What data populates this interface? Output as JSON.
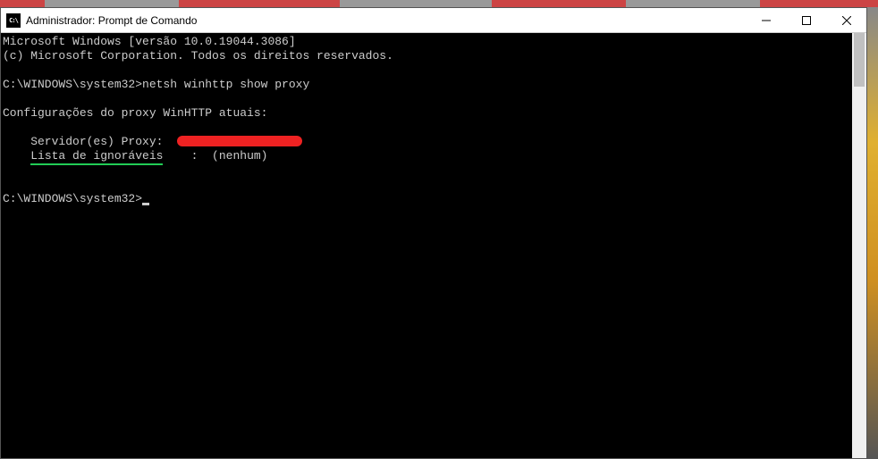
{
  "titlebar": {
    "icon_text": "C:\\",
    "title": "Administrador: Prompt de Comando"
  },
  "terminal": {
    "line1": "Microsoft Windows [versão 10.0.19044.3086]",
    "line2": "(c) Microsoft Corporation. Todos os direitos reservados.",
    "prompt1_path": "C:\\WINDOWS\\system32>",
    "command1": "netsh winhttp show proxy",
    "config_header": "Configurações do proxy WinHTTP atuais:",
    "proxy_label": "    Servidor(es) Proxy:  ",
    "bypass_label_indent": "    ",
    "bypass_label": "Lista de ignoráveis",
    "bypass_value": "    :  (nenhum)",
    "prompt2_path": "C:\\WINDOWS\\system32>"
  }
}
